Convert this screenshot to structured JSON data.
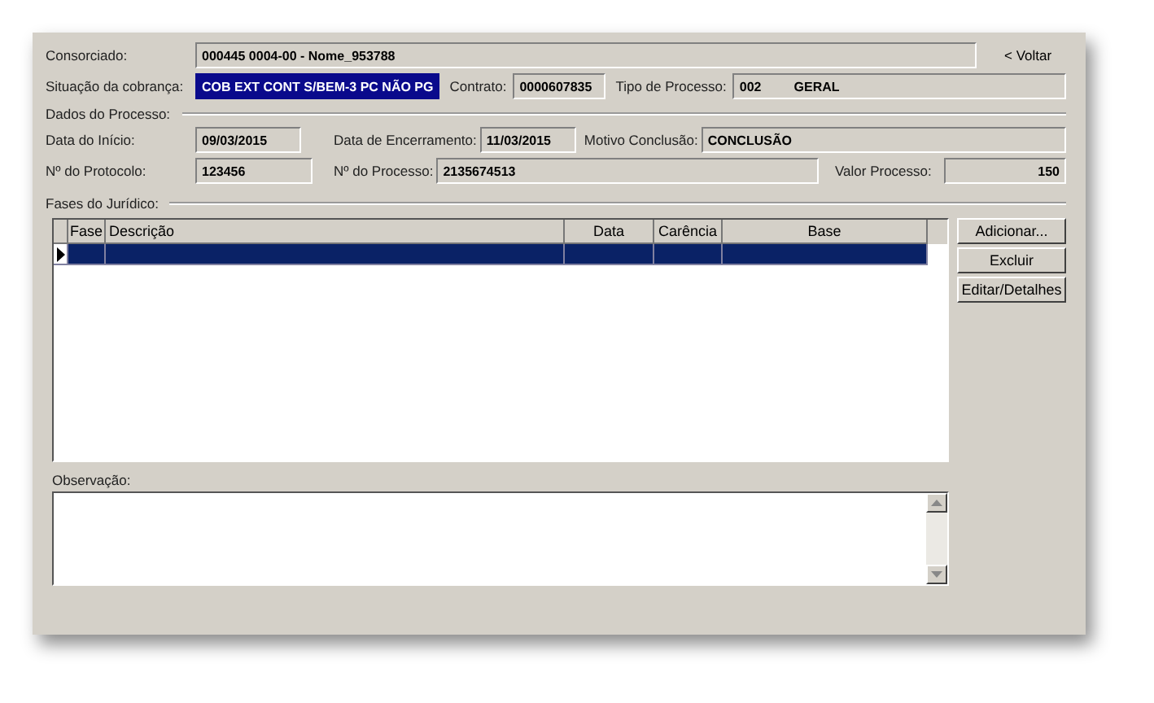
{
  "consorciado": {
    "label": "Consorciado:",
    "value": "000445 0004-00 - Nome_953788"
  },
  "back_link": "< Voltar",
  "situacao": {
    "label": "Situação da cobrança:",
    "value": "COB EXT CONT S/BEM-3 PC NÃO PG",
    "selected": true
  },
  "contrato": {
    "label": "Contrato:",
    "value": "0000607835"
  },
  "tipo_processo": {
    "label": "Tipo de Processo:",
    "code": "002",
    "value": "GERAL"
  },
  "dados_section": "Dados do Processo:",
  "data_inicio": {
    "label": "Data do Início:",
    "value": "09/03/2015"
  },
  "data_encerramento": {
    "label": "Data de Encerramento:",
    "value": "11/03/2015"
  },
  "motivo": {
    "label": "Motivo Conclusão:",
    "value": "CONCLUSÃO"
  },
  "protocolo": {
    "label": "Nº do Protocolo:",
    "value": "123456"
  },
  "numero_processo": {
    "label": "Nº do Processo:",
    "value": "2135674513"
  },
  "valor_processo": {
    "label": "Valor Processo:",
    "value": "150"
  },
  "fases_section": "Fases do Jurídico:",
  "table": {
    "columns": [
      "Fase",
      "Descrição",
      "Data",
      "Carência",
      "Base"
    ],
    "rows": [
      {
        "selected": true
      }
    ]
  },
  "buttons": [
    "Adicionar...",
    "Excluir",
    "Editar/Detalhes"
  ],
  "observacao": {
    "label": "Observação:"
  }
}
